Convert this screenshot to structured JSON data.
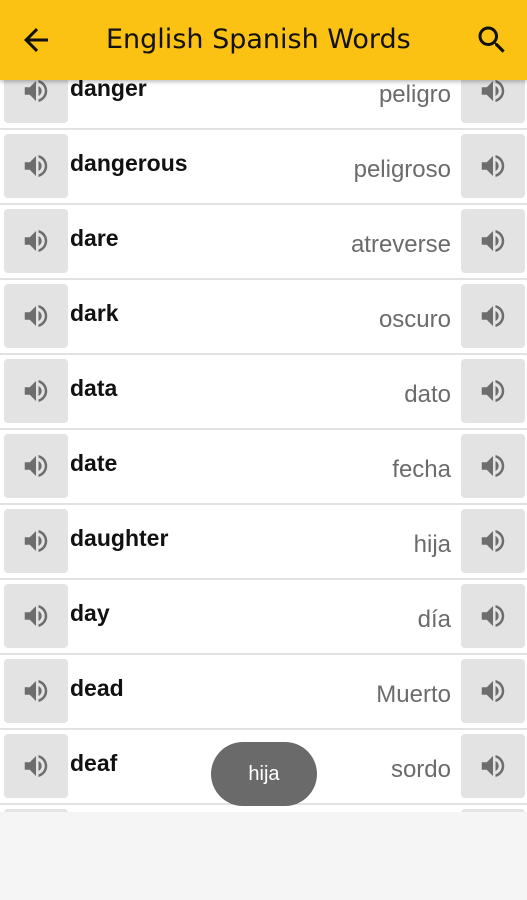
{
  "appbar": {
    "title": "English Spanish Words",
    "back_icon": "arrow-left-icon",
    "search_icon": "search-icon"
  },
  "words": [
    {
      "en": "danger",
      "es": "peligro"
    },
    {
      "en": "dangerous",
      "es": "peligroso"
    },
    {
      "en": "dare",
      "es": "atreverse"
    },
    {
      "en": "dark",
      "es": "oscuro"
    },
    {
      "en": "data",
      "es": "dato"
    },
    {
      "en": "date",
      "es": "fecha"
    },
    {
      "en": "daughter",
      "es": "hija"
    },
    {
      "en": "day",
      "es": "día"
    },
    {
      "en": "dead",
      "es": "Muerto"
    },
    {
      "en": "deaf",
      "es": "sordo"
    },
    {
      "en": "",
      "es": ""
    }
  ],
  "toast": {
    "text": "hija"
  },
  "colors": {
    "appbar": "#fbc113",
    "speaker_bg": "#e3e3e3",
    "toast_bg": "#6a6a6a"
  }
}
